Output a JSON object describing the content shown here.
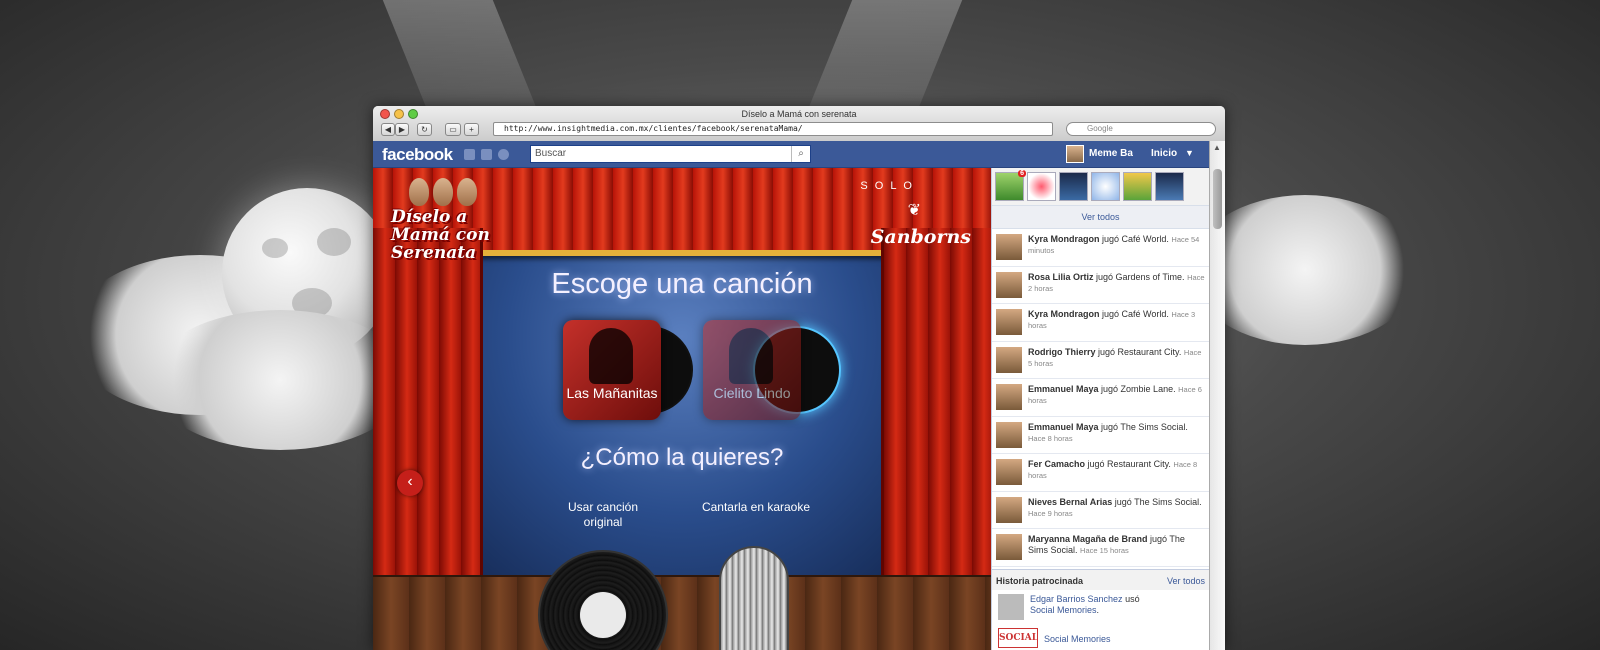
{
  "browser": {
    "title": "Díselo a Mamá con serenata",
    "url": "http://www.insightmedia.com.mx/clientes/facebook/serenataMama/",
    "search_placeholder": "Google"
  },
  "facebook": {
    "logo": "facebook",
    "search_placeholder": "Buscar",
    "user_name": "Meme Ba",
    "home_label": "Inicio"
  },
  "app": {
    "logo_left": "Díselo a Mamá con Serenata",
    "solo": "SOLO",
    "brand": "Sanborns",
    "heading": "Escoge una canción",
    "songs": [
      {
        "label": "Las Mañanitas"
      },
      {
        "label": "Cielito Lindo"
      }
    ],
    "question": "¿Cómo la quieres?",
    "options": [
      {
        "label": "Usar canción original"
      },
      {
        "label": "Cantarla en karaoke"
      }
    ]
  },
  "sidebar": {
    "game_badge": "6",
    "see_all": "Ver todos",
    "ticker": [
      {
        "name": "Kyra Mondragon",
        "action": " jugó Café World.",
        "time": "Hace 54 minutos"
      },
      {
        "name": "Rosa Lilia Ortiz",
        "action": " jugó Gardens of Time.",
        "time": "Hace 2 horas"
      },
      {
        "name": "Kyra Mondragon",
        "action": " jugó Café World.",
        "time": "Hace 3 horas"
      },
      {
        "name": "Rodrigo Thierry",
        "action": " jugó Restaurant City.",
        "time": "Hace 5 horas"
      },
      {
        "name": "Emmanuel Maya",
        "action": " jugó Zombie Lane.",
        "time": "Hace 6 horas"
      },
      {
        "name": "Emmanuel Maya",
        "action": " jugó The Sims Social.",
        "time": "Hace 8 horas"
      },
      {
        "name": "Fer Camacho",
        "action": " jugó Restaurant City.",
        "time": "Hace 8 horas"
      },
      {
        "name": "Nieves Bernal Arias",
        "action": " jugó The Sims Social.",
        "time": "Hace 9 horas"
      },
      {
        "name": "Maryanna Magaña de Brand",
        "action": " jugó The Sims Social.",
        "time": "Hace 15 horas"
      }
    ],
    "sponsored": {
      "title": "Historia patrocinada",
      "see_all": "Ver todos",
      "story_name": "Edgar Barrios Sanchez",
      "story_verb": " usó",
      "story_app": "Social Memories",
      "story_end": ".",
      "ad_logo": "SOCIAL",
      "ad_name": "Social Memories"
    }
  }
}
